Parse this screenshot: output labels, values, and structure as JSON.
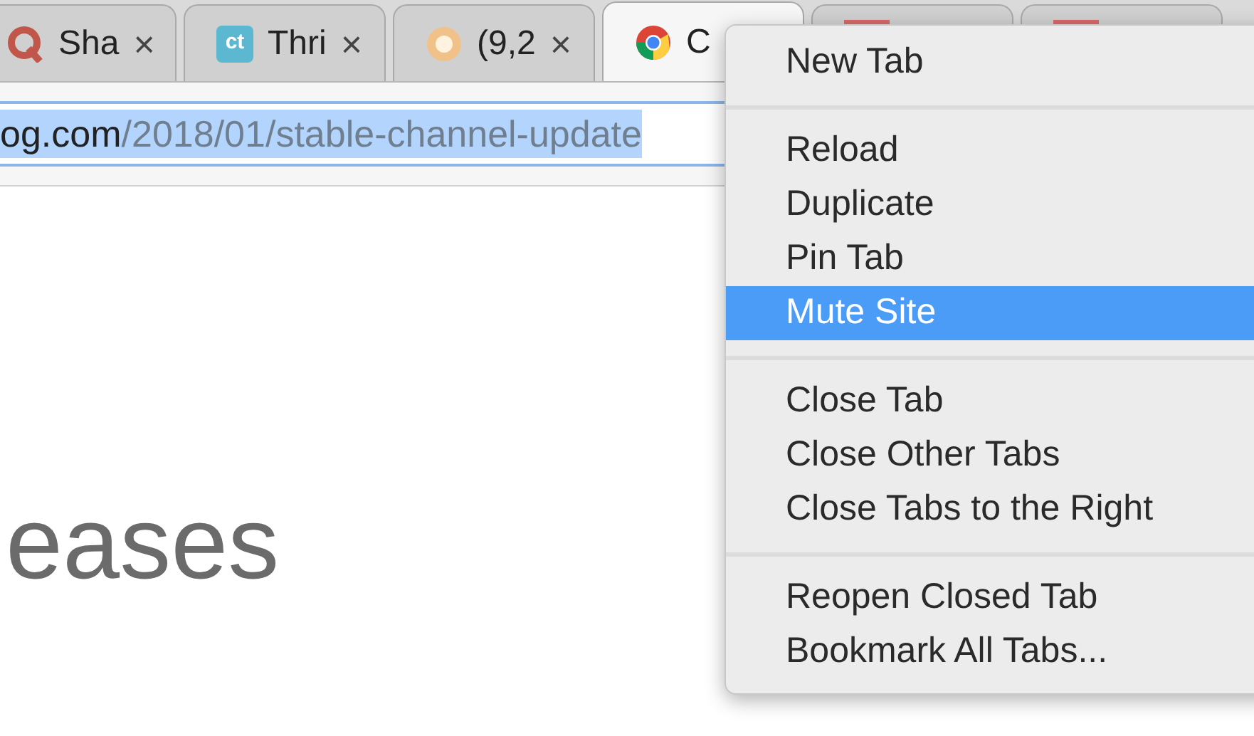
{
  "tabs": [
    {
      "kind": "q",
      "title": "Sha",
      "close": "×",
      "selected": false
    },
    {
      "kind": "ct",
      "favicon_text": "ct",
      "title": "Thri",
      "close": "×",
      "selected": false
    },
    {
      "kind": "sun",
      "title": "(9,2",
      "close": "×",
      "selected": false
    },
    {
      "kind": "chrome",
      "title": "C",
      "selected": true
    },
    {
      "kind": "red",
      "selected": false
    },
    {
      "kind": "red",
      "selected": false
    }
  ],
  "address_bar": {
    "domain": "og.com",
    "path": "/2018/01/stable-channel-update"
  },
  "page": {
    "heading": "eases"
  },
  "context_menu": {
    "groups": [
      [
        {
          "label": "New Tab",
          "selected": false
        }
      ],
      [
        {
          "label": "Reload",
          "selected": false
        },
        {
          "label": "Duplicate",
          "selected": false
        },
        {
          "label": "Pin Tab",
          "selected": false
        },
        {
          "label": "Mute Site",
          "selected": true
        }
      ],
      [
        {
          "label": "Close Tab",
          "selected": false
        },
        {
          "label": "Close Other Tabs",
          "selected": false
        },
        {
          "label": "Close Tabs to the Right",
          "selected": false
        }
      ],
      [
        {
          "label": "Reopen Closed Tab",
          "selected": false
        },
        {
          "label": "Bookmark All Tabs...",
          "selected": false
        }
      ]
    ]
  }
}
